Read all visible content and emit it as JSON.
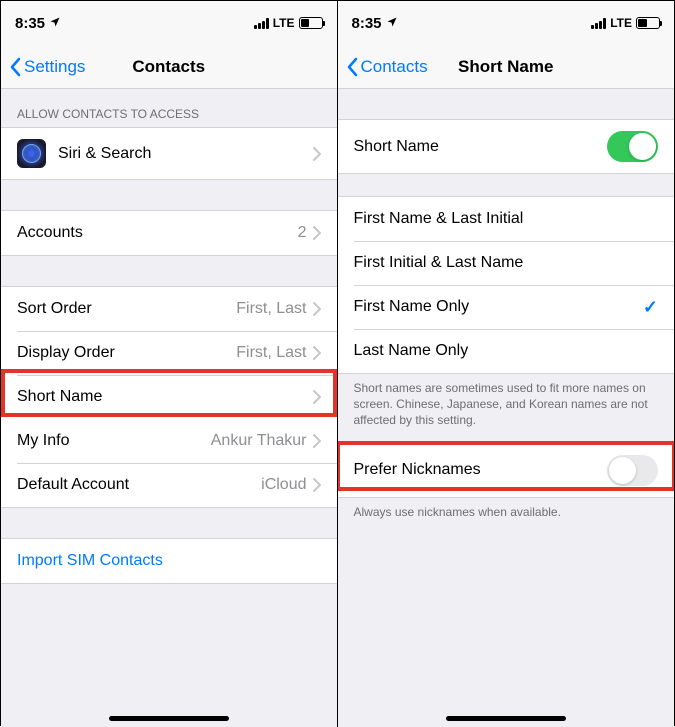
{
  "left": {
    "status": {
      "time": "8:35",
      "net": "LTE"
    },
    "nav": {
      "back": "Settings",
      "title": "Contacts"
    },
    "section_header": "ALLOW CONTACTS TO ACCESS",
    "siri_label": "Siri & Search",
    "accounts": {
      "label": "Accounts",
      "value": "2"
    },
    "sort_order": {
      "label": "Sort Order",
      "value": "First, Last"
    },
    "display_order": {
      "label": "Display Order",
      "value": "First, Last"
    },
    "short_name": {
      "label": "Short Name"
    },
    "my_info": {
      "label": "My Info",
      "value": "Ankur Thakur"
    },
    "default_account": {
      "label": "Default Account",
      "value": "iCloud"
    },
    "import_sim": "Import SIM Contacts"
  },
  "right": {
    "status": {
      "time": "8:35",
      "net": "LTE"
    },
    "nav": {
      "back": "Contacts",
      "title": "Short Name"
    },
    "short_name_toggle": {
      "label": "Short Name"
    },
    "options": {
      "fnli": "First Name & Last Initial",
      "filn": "First Initial & Last Name",
      "fno": "First Name Only",
      "lno": "Last Name Only"
    },
    "footer": "Short names are sometimes used to fit more names on screen. Chinese, Japanese, and Korean names are not affected by this setting.",
    "prefer_nicknames": {
      "label": "Prefer Nicknames"
    },
    "footer2": "Always use nicknames when available."
  }
}
